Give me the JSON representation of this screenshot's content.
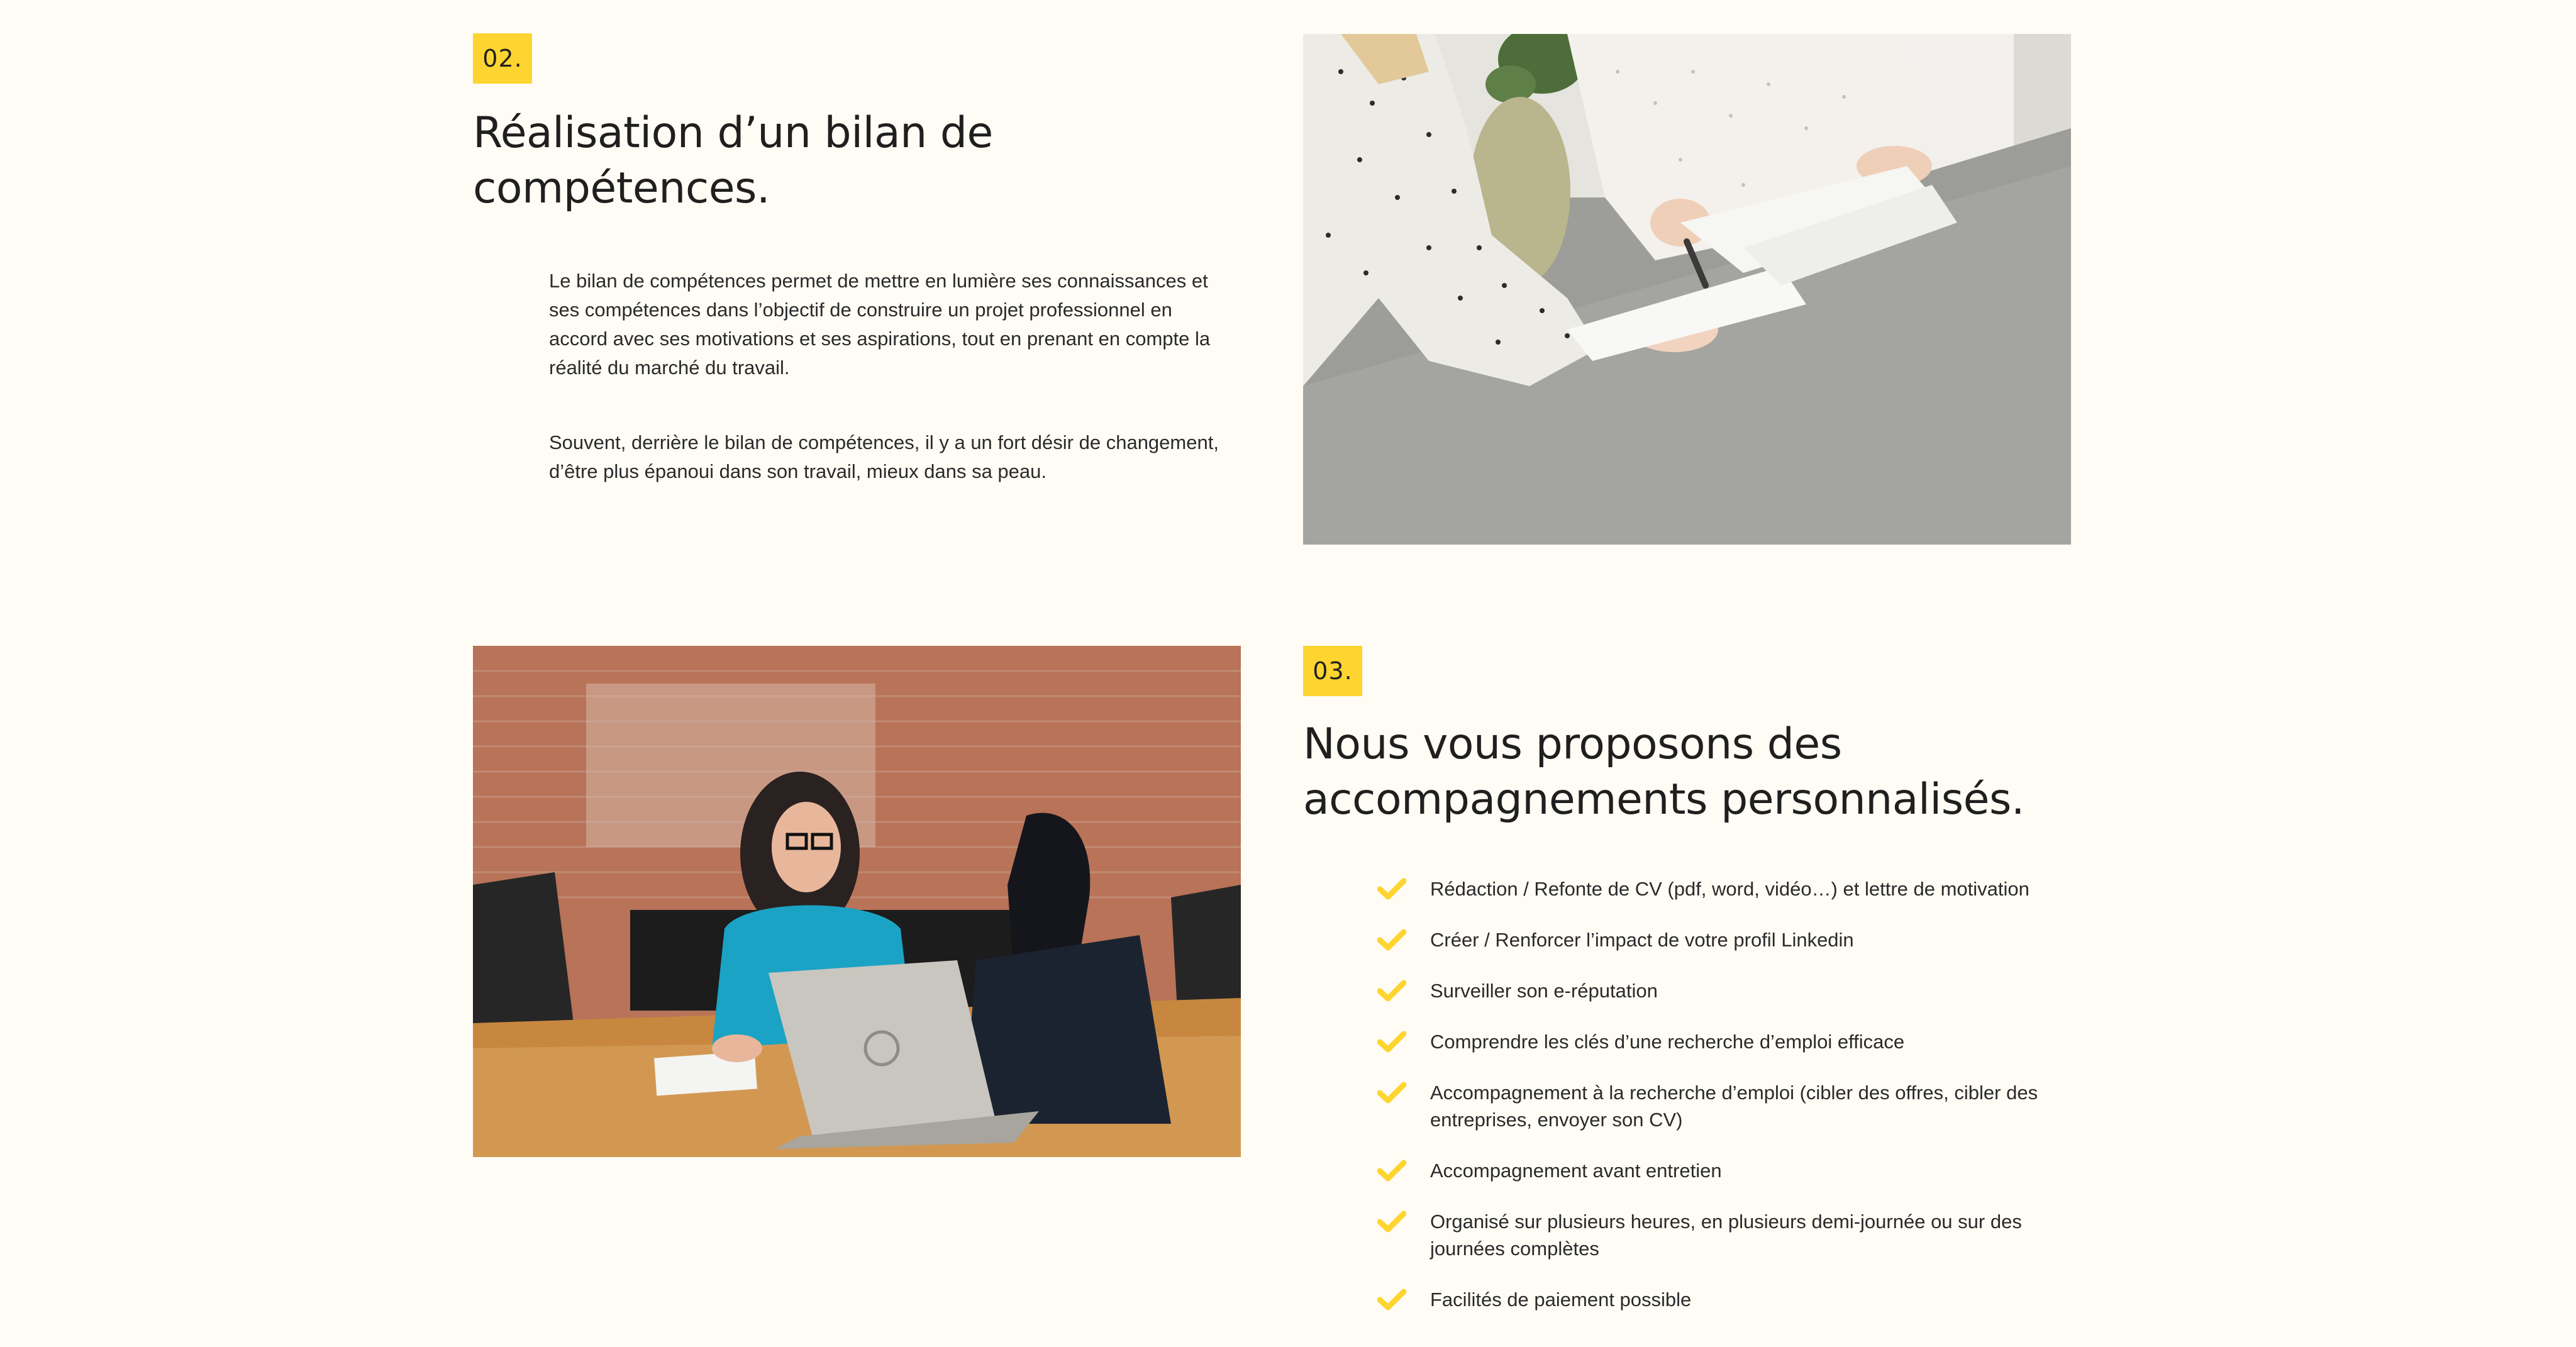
{
  "section_02": {
    "number": "02.",
    "title_line1": "Réalisation d’un bilan de",
    "title_line2": "compétences.",
    "paragraph1_lines": [
      "Le bilan de compétences permet de mettre en lumière ses connaissances et",
      "ses compétences dans l’objectif de construire un projet professionnel en",
      "accord avec ses motivations et ses aspirations, tout en prenant en compte la",
      "réalité du marché du travail."
    ],
    "paragraph2_lines": [
      "Souvent, derrière le bilan de compétences, il y a un fort désir de changement,",
      "d’être plus épanoui dans son travail, mieux dans sa peau."
    ]
  },
  "section_03": {
    "number": "03.",
    "title_line1": "Nous vous proposons des",
    "title_line2": "accompagnements personnalisés.",
    "items": [
      "Rédaction / Refonte de CV (pdf, word, vidéo…) et lettre de motivation",
      "Créer / Renforcer l’impact de votre profil Linkedin",
      "Surveiller son e-réputation",
      "Comprendre les clés d’une recherche d’emploi efficace",
      "Accompagnement à la recherche d’emploi (cibler des offres, cibler des entreprises, envoyer son CV)",
      "Accompagnement avant entretien",
      "Organisé sur plusieurs heures, en plusieurs demi-journée ou sur des journées complètes",
      "Facilités de paiement possible"
    ]
  },
  "icons": {
    "check": "check-icon"
  },
  "colors": {
    "background": "#fefcf4",
    "accent_yellow": "#fed530",
    "text": "#1e1e1e"
  }
}
